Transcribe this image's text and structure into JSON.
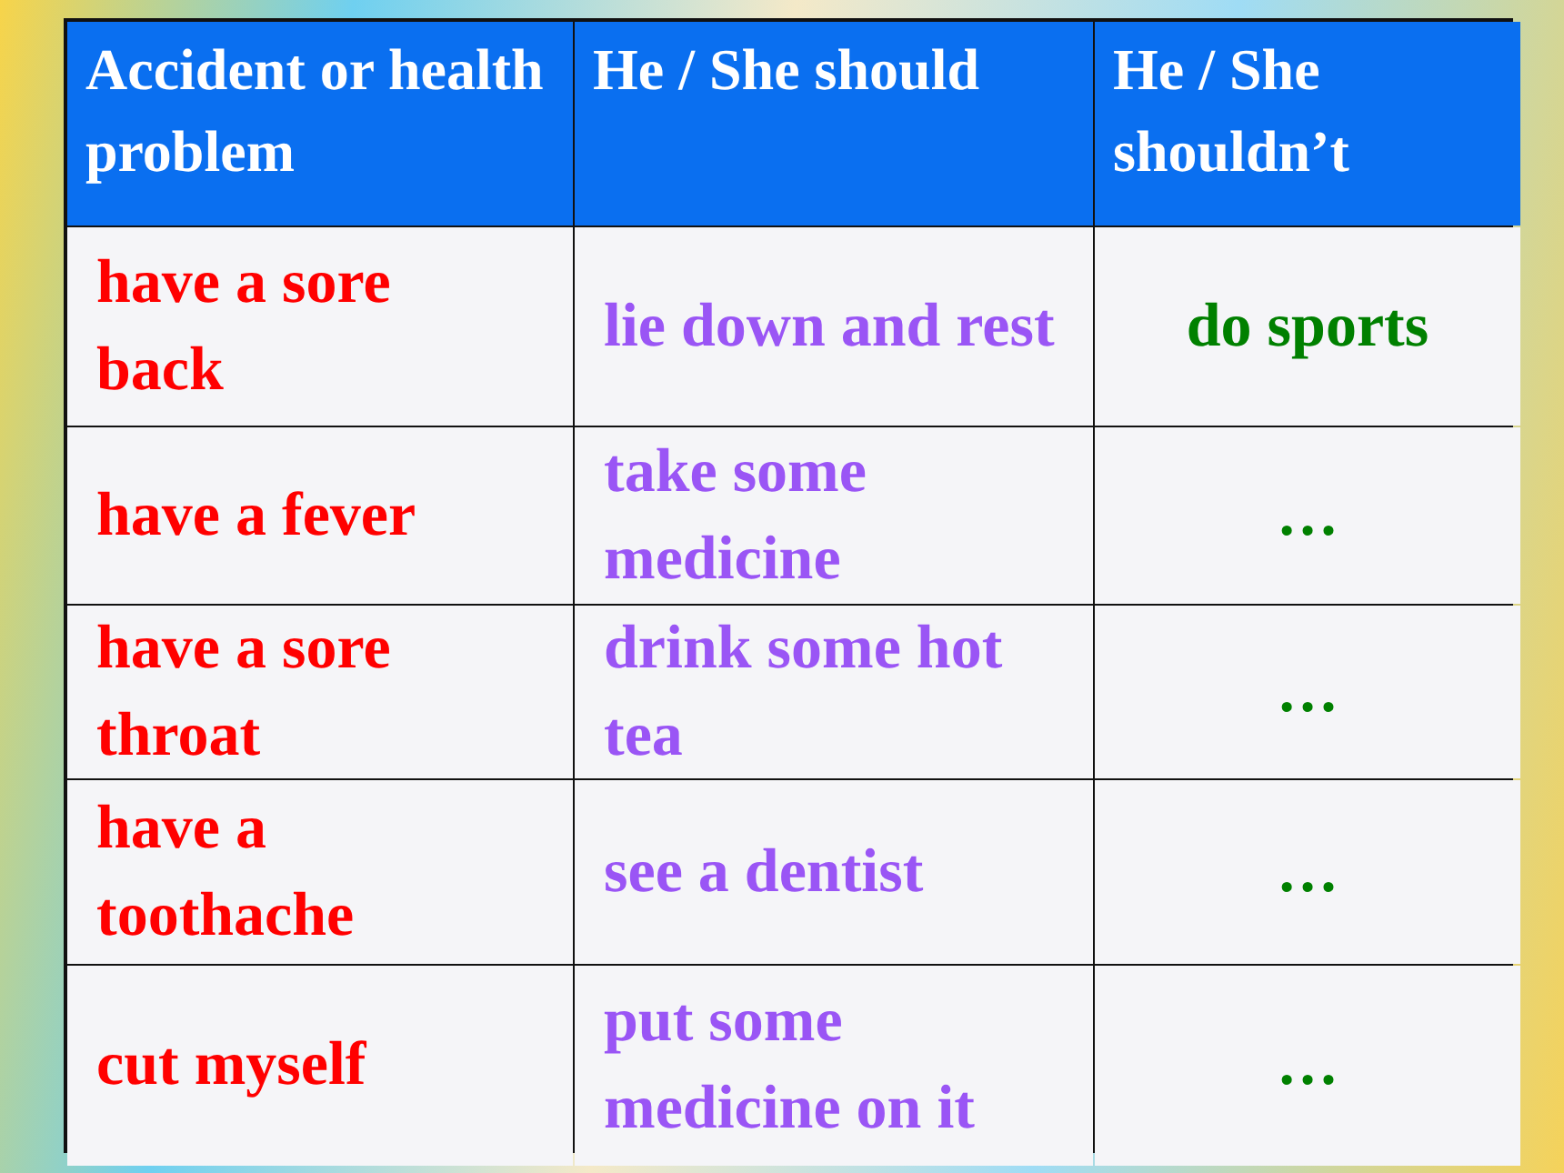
{
  "table": {
    "columns": [
      "Accident or health problem",
      "He / She should",
      "He / She shouldn’t"
    ],
    "rows": [
      {
        "problem": "have a sore back",
        "should": "lie down and rest",
        "shouldnt": "do sports"
      },
      {
        "problem": "have a fever",
        "should": "take some medicine",
        "shouldnt": "…"
      },
      {
        "problem": "have a sore throat",
        "should": "drink some hot tea",
        "shouldnt": "…"
      },
      {
        "problem": "have a toothache",
        "should": "see a dentist",
        "shouldnt": "…"
      },
      {
        "problem": "cut myself",
        "should": "put some medicine on it",
        "shouldnt": "…"
      }
    ]
  }
}
